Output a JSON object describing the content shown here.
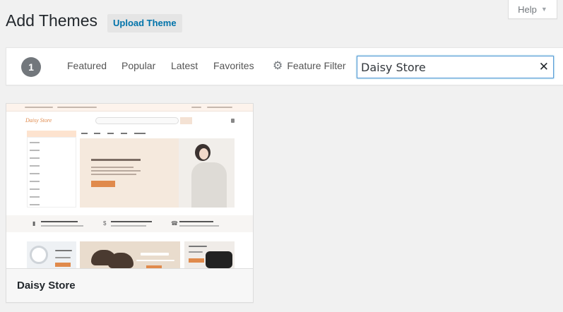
{
  "help_tab": {
    "label": "Help"
  },
  "header": {
    "title": "Add Themes",
    "upload_label": "Upload Theme"
  },
  "filter_bar": {
    "count": "1",
    "tabs": [
      {
        "label": "Featured"
      },
      {
        "label": "Popular"
      },
      {
        "label": "Latest"
      },
      {
        "label": "Favorites"
      }
    ],
    "feature_filter_label": "Feature Filter",
    "search_value": "Daisy Store"
  },
  "themes": [
    {
      "name": "Daisy Store",
      "preview": {
        "logo": "Daisy Store",
        "accent_color": "#e08a4c"
      }
    }
  ],
  "colors": {
    "link": "#0073aa",
    "focus_border": "#5b9dd9",
    "badge": "#72777c"
  }
}
